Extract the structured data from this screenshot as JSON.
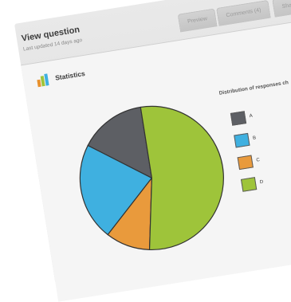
{
  "header": {
    "title": "View question",
    "subtitle": "Last updated 14 days ago"
  },
  "tabs": [
    {
      "label": "Preview"
    },
    {
      "label": "Comments (4)"
    },
    {
      "label": "Sharing"
    }
  ],
  "card": {
    "title": "Statistics",
    "icon": "bar-chart-icon"
  },
  "chart_data": {
    "type": "pie",
    "title": "Distribution of responses ch",
    "categories": [
      "A",
      "B",
      "C",
      "D"
    ],
    "values": [
      15,
      22,
      10,
      53
    ],
    "colors": [
      "#5d5f64",
      "#3fb0e0",
      "#e99a3c",
      "#9ec43a"
    ]
  }
}
